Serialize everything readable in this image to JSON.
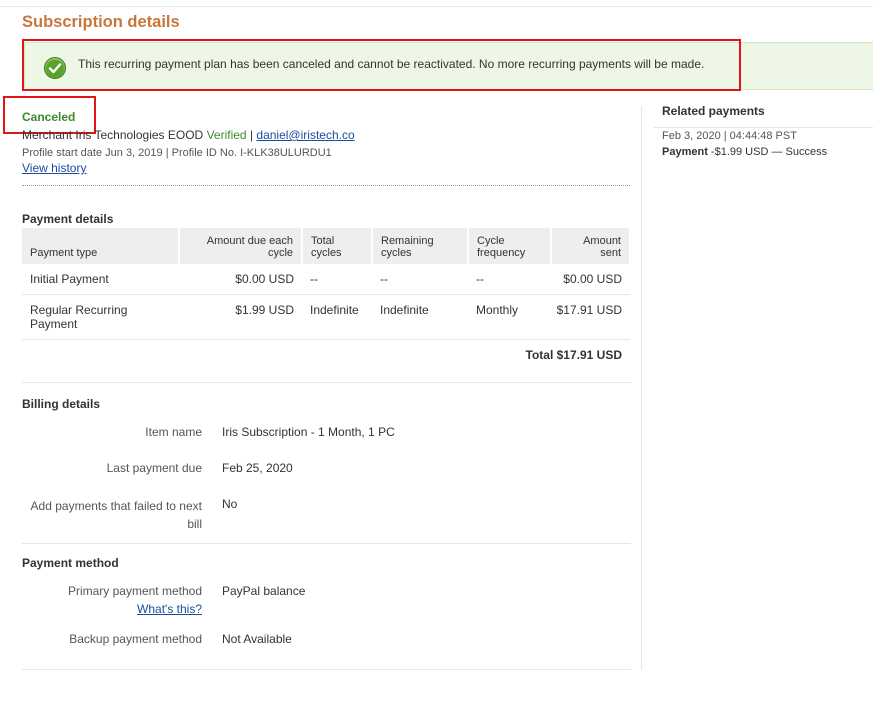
{
  "page": {
    "title": "Subscription details"
  },
  "notice": {
    "message": "This recurring payment plan has been canceled and cannot be reactivated. No more recurring payments will be made.",
    "icon": "check-circle-icon",
    "color": "#5aa12b"
  },
  "profile": {
    "status": "Canceled",
    "merchant_prefix": "Merchant",
    "merchant_name": "Iris Technologies EOOD",
    "verified": "Verified",
    "separator": "|",
    "email": "daniel@iristech.co",
    "profile_line": "Profile start date Jun 3, 2019 | Profile ID No. I-KLK38ULURDU1",
    "view_history": "View history"
  },
  "payment_details": {
    "heading": "Payment details",
    "columns": [
      "Payment type",
      "Amount due each cycle",
      "Total cycles",
      "Remaining cycles",
      "Cycle frequency",
      "Amount sent"
    ],
    "rows": [
      {
        "type": "Initial Payment",
        "amount_due": "$0.00 USD",
        "total_cycles": "--",
        "remaining": "--",
        "frequency": "--",
        "sent": "$0.00 USD"
      },
      {
        "type": "Regular Recurring Payment",
        "amount_due": "$1.99 USD",
        "total_cycles": "Indefinite",
        "remaining": "Indefinite",
        "frequency": "Monthly",
        "sent": "$17.91 USD"
      }
    ],
    "total": "Total $17.91 USD"
  },
  "billing_details": {
    "heading": "Billing details",
    "item_name_label": "Item name",
    "item_name_value": "Iris Subscription - 1 Month, 1 PC",
    "last_payment_label": "Last payment due",
    "last_payment_value": "Feb 25, 2020",
    "failed_label": "Add payments that failed to next bill",
    "failed_value": "No"
  },
  "payment_method": {
    "heading": "Payment method",
    "primary_label": "Primary payment method",
    "whats_this": "What's this?",
    "primary_value": "PayPal balance",
    "backup_label": "Backup payment method",
    "backup_value": "Not Available"
  },
  "related": {
    "heading": "Related payments",
    "date": "Feb 3, 2020 | 04:44:48 PST",
    "entry_label": "Payment",
    "entry_detail": "-$1.99 USD — Success"
  },
  "colors": {
    "title": "#c8763a",
    "status_green": "#3e8a2f",
    "link": "#1a4da1",
    "highlight_red": "#e0151a"
  }
}
